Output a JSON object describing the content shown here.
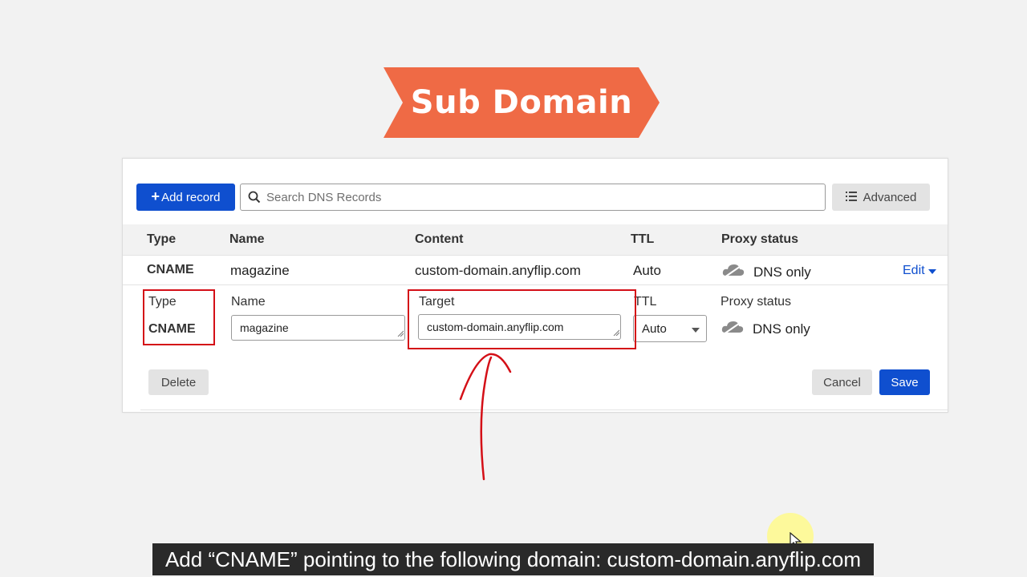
{
  "banner": {
    "title": "Sub Domain",
    "color": "#ef6a45"
  },
  "toolbar": {
    "add_record_label": "Add record",
    "search_placeholder": "Search DNS Records",
    "advanced_label": "Advanced"
  },
  "table": {
    "headers": {
      "type": "Type",
      "name": "Name",
      "content": "Content",
      "ttl": "TTL",
      "proxy": "Proxy status"
    },
    "record": {
      "type": "CNAME",
      "name": "magazine",
      "content": "custom-domain.anyflip.com",
      "ttl": "Auto",
      "proxy": "DNS only",
      "edit_label": "Edit"
    }
  },
  "edit_form": {
    "type_label": "Type",
    "type_value": "CNAME",
    "name_label": "Name",
    "name_value": "magazine",
    "target_label": "Target",
    "target_value": "custom-domain.anyflip.com",
    "ttl_label": "TTL",
    "ttl_value": "Auto",
    "proxy_label": "Proxy status",
    "proxy_value": "DNS only",
    "delete_label": "Delete",
    "cancel_label": "Cancel",
    "save_label": "Save"
  },
  "caption": "Add “CNAME” pointing to the following domain: custom-domain.anyflip.com",
  "colors": {
    "primary": "#0f4fcf",
    "highlight": "#d40f17",
    "background": "#f2f2f2"
  }
}
